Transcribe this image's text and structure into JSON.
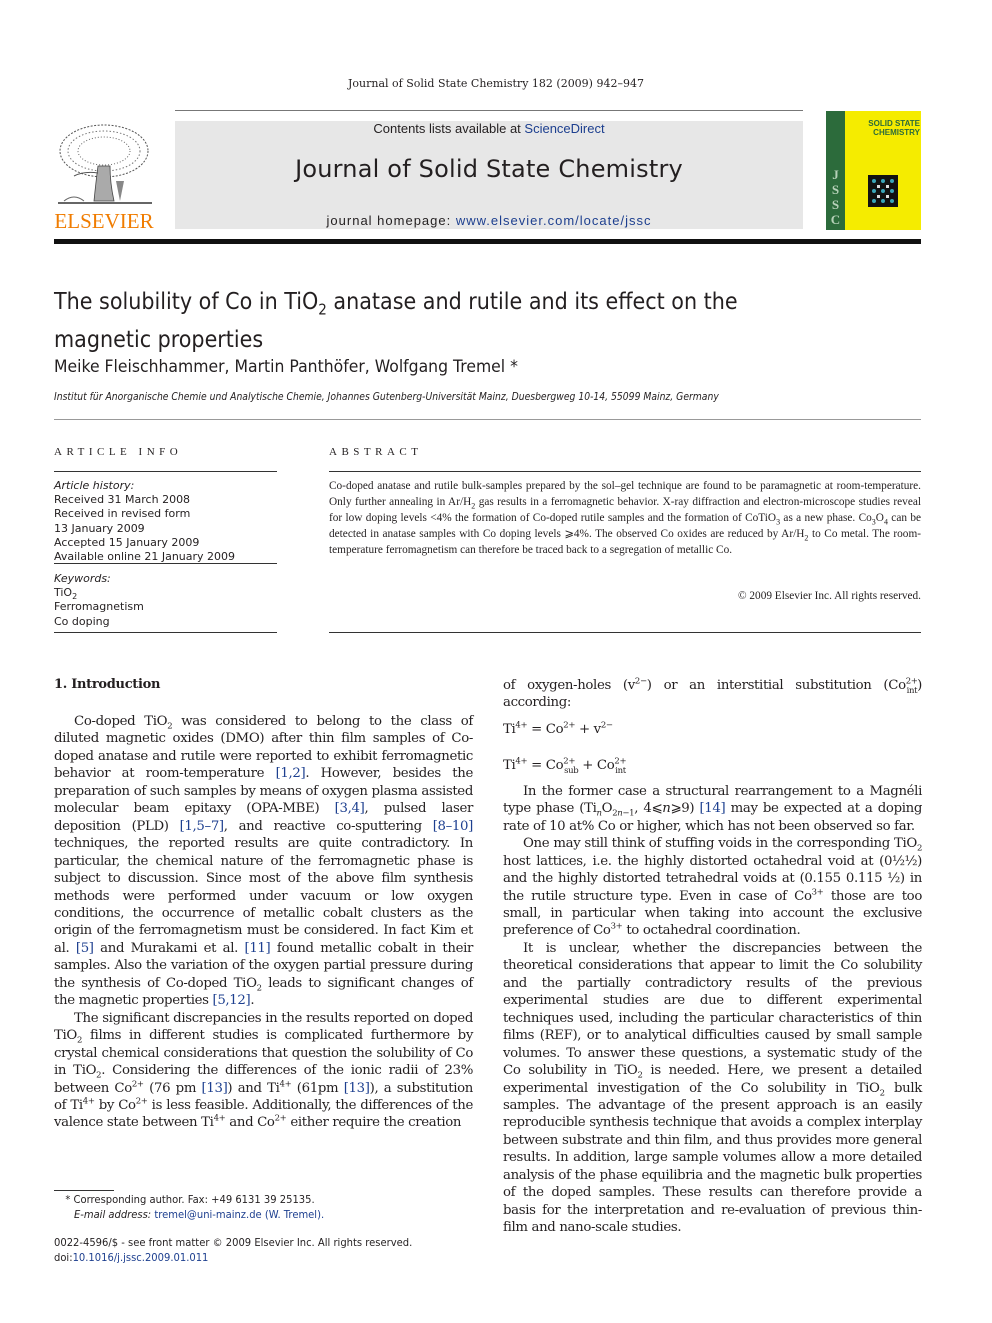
{
  "running_header": "Journal of Solid State Chemistry 182 (2009) 942–947",
  "masthead": {
    "publisher_logo_text": "ELSEVIER",
    "contents_prefix": "Contents lists available at ",
    "contents_link": "ScienceDirect",
    "journal_title": "Journal of Solid State Chemistry",
    "homepage_prefix": "journal homepage: ",
    "homepage_link": "www.elsevier.com/locate/jssc",
    "cover": {
      "title_line1": "SOLID STATE",
      "title_line2": "CHEMISTRY",
      "spine_letters": [
        "J",
        "S",
        "S",
        "C"
      ],
      "colors": {
        "background": "#f5ec00",
        "spine": "#2c6b3b"
      }
    },
    "colors": {
      "logo": "#f07c00",
      "link": "#1d3f8f",
      "banner": "#e7e7e7"
    }
  },
  "article": {
    "title_part1": "The solubility of Co in TiO",
    "title_sub": "2",
    "title_part2": " anatase and rutile and its effect on the",
    "title_line2": "magnetic properties",
    "authors": "Meike Fleischhammer, Martin Panthöfer, Wolfgang Tremel *",
    "affiliation": "Institut für Anorganische Chemie und Analytische Chemie, Johannes Gutenberg-Universität Mainz, Duesbergweg 10-14, 55099 Mainz, Germany"
  },
  "article_info": {
    "heading": "ARTICLE INFO",
    "history_label": "Article history:",
    "history": [
      "Received 31 March 2008",
      "Received in revised form",
      "13 January 2009",
      "Accepted 15 January 2009",
      "Available online 21 January 2009"
    ],
    "keywords_label": "Keywords:",
    "keywords": [
      "TiO2",
      "Ferromagnetism",
      "Co doping"
    ]
  },
  "abstract": {
    "heading": "ABSTRACT",
    "copyright": "© 2009 Elsevier Inc. All rights reserved."
  },
  "introduction": {
    "heading": "1.  Introduction",
    "refs": [
      "[1,2]",
      "[3,4]",
      "[1,5–7]",
      "[8–10]",
      "[5]",
      "[11]",
      "[5,12]",
      "[13]",
      "[13]",
      "[14]"
    ]
  },
  "footnotes": {
    "corresponding": "* Corresponding author. Fax: +49 6131 39 25135.",
    "email_label": "E-mail address: ",
    "email": "tremel@uni-mainz.de (W. Tremel).",
    "issn": "0022-4596/$ - see front matter © 2009 Elsevier Inc. All rights reserved.",
    "doi_label": "doi:",
    "doi": "10.1016/j.jssc.2009.01.011"
  }
}
